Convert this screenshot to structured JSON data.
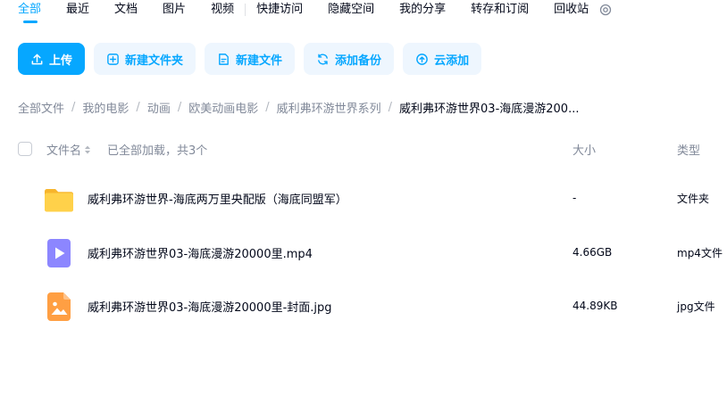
{
  "tabs": [
    {
      "label": "全部",
      "active": true
    },
    {
      "label": "最近"
    },
    {
      "label": "文档"
    },
    {
      "label": "图片"
    },
    {
      "label": "视频"
    },
    {
      "label": "快捷访问"
    },
    {
      "label": "隐藏空间"
    },
    {
      "label": "我的分享"
    },
    {
      "label": "转存和订阅"
    },
    {
      "label": "回收站"
    }
  ],
  "toolbar": {
    "upload": "上传",
    "new_folder": "新建文件夹",
    "new_file": "新建文件",
    "add_backup": "添加备份",
    "cloud_add": "云添加"
  },
  "breadcrumb": [
    "全部文件",
    "我的电影",
    "动画",
    "欧美动画电影",
    "威利弗环游世界系列",
    "威利弗环游世界03-海底漫游200..."
  ],
  "table": {
    "col_name": "文件名",
    "loaded_status": "已全部加载，共3个",
    "col_size": "大小",
    "col_type": "类型",
    "rows": [
      {
        "name": "威利弗环游世界-海底两万里央配版（海底同盟军）",
        "size": "-",
        "type": "文件夹",
        "icon": "folder-icon"
      },
      {
        "name": "威利弗环游世界03-海底漫游20000里.mp4",
        "size": "4.66GB",
        "type": "mp4文件",
        "icon": "video-file-icon"
      },
      {
        "name": "威利弗环游世界03-海底漫游20000里-封面.jpg",
        "size": "44.89KB",
        "type": "jpg文件",
        "icon": "image-file-icon"
      }
    ]
  },
  "colors": {
    "accent": "#06a7ff",
    "button_bg": "#eef6fe",
    "folder": "#ffc73a",
    "video": "#8c86ff",
    "image": "#ff9f43"
  }
}
